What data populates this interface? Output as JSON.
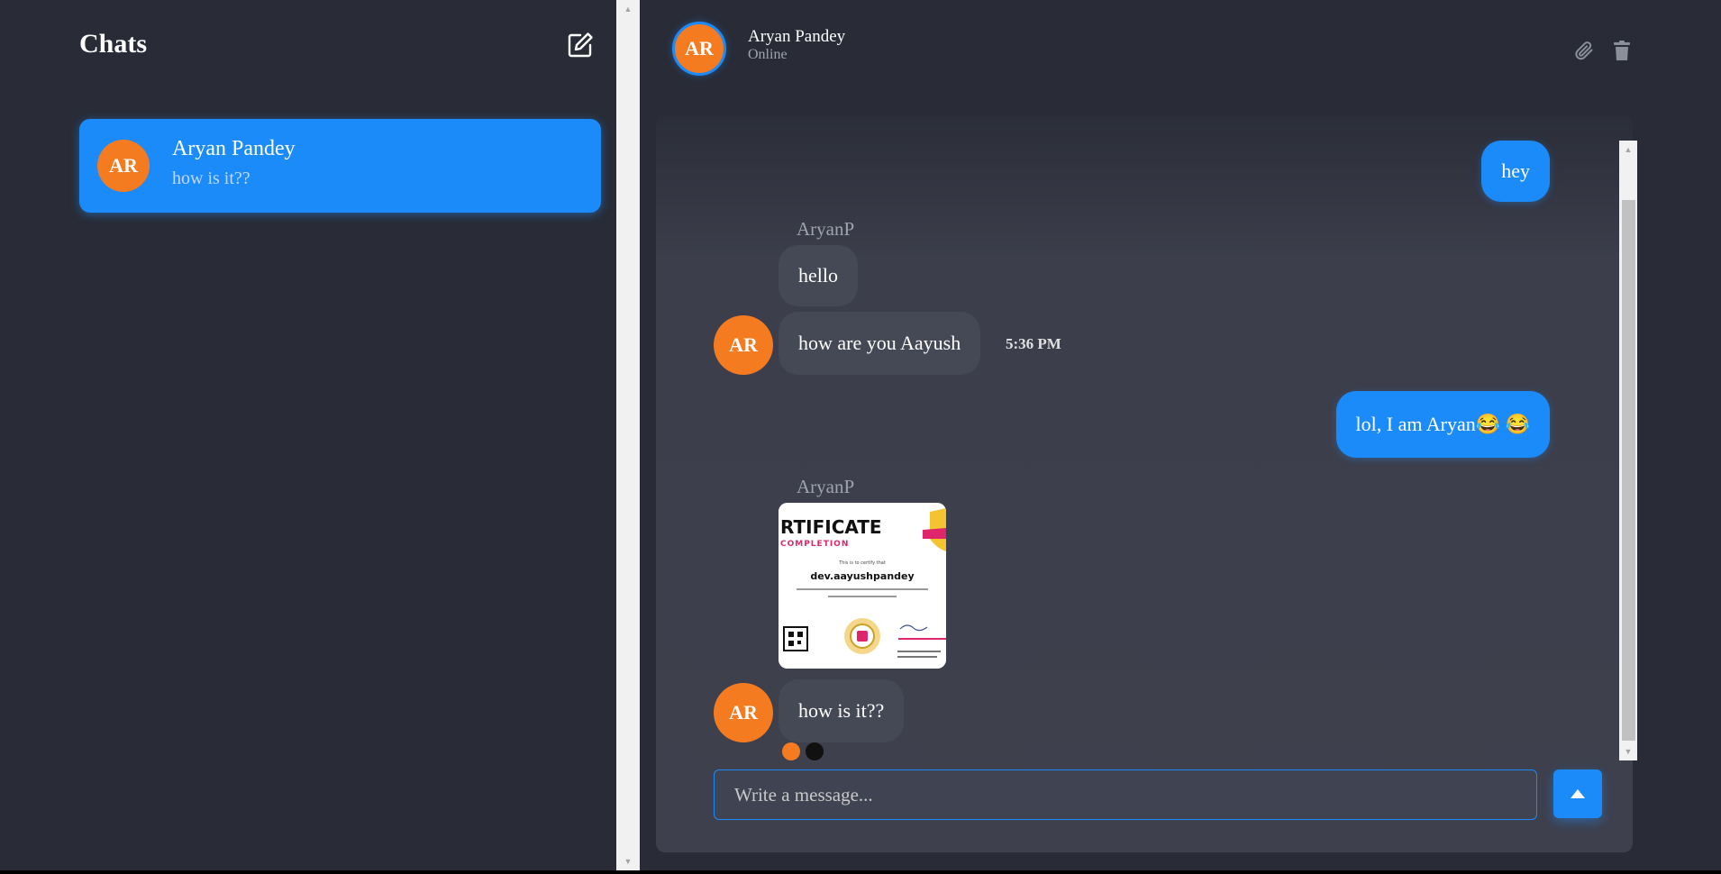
{
  "sidebar": {
    "title": "Chats",
    "new_chat_icon": "edit-square-icon",
    "chats": [
      {
        "initials": "AR",
        "name": "Aryan Pandey",
        "last_message": "how is it??"
      }
    ]
  },
  "header": {
    "initials": "AR",
    "name": "Aryan Pandey",
    "status": "Online",
    "icons": [
      "paperclip-icon",
      "trash-icon"
    ]
  },
  "messages": [
    {
      "direction": "out",
      "text": "hey"
    },
    {
      "direction": "in",
      "sender": "AryanP",
      "text": "hello"
    },
    {
      "direction": "in",
      "initials": "AR",
      "text": "how are you Aayush",
      "time": "5:36 PM"
    },
    {
      "direction": "out",
      "text": "lol, I am Aryan😂 😂"
    },
    {
      "direction": "in",
      "sender": "AryanP",
      "type": "image",
      "image": {
        "heading": "RTIFICATE",
        "subheading": "COMPLETION",
        "certify_line": "This is to certify that",
        "recipient": "dev.aayushpandey"
      }
    },
    {
      "direction": "in",
      "initials": "AR",
      "text": "how is it??"
    }
  ],
  "typing_indicator": {
    "dot_colors": [
      "#f47b20",
      "#111111"
    ]
  },
  "composer": {
    "placeholder": "Write a message...",
    "send_icon": "caret-up-icon"
  },
  "colors": {
    "accent": "#1c8bfa",
    "avatar": "#f47b20",
    "background": "#292c37",
    "incoming_bubble": "#454855"
  }
}
